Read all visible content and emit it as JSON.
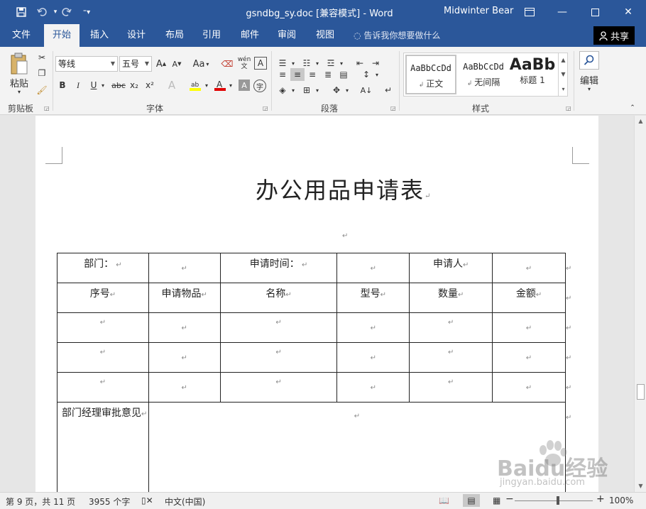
{
  "titlebar": {
    "title": "gsndbg_sy.doc [兼容模式] - Word",
    "user": "Midwinter Bear",
    "save_icon": "save-icon",
    "undo_icon": "undo-icon",
    "redo_icon": "redo-icon"
  },
  "tabs": [
    "文件",
    "开始",
    "插入",
    "设计",
    "布局",
    "引用",
    "邮件",
    "审阅",
    "视图"
  ],
  "active_tab": "开始",
  "tell_me": "告诉我你想要做什么",
  "share": "共享",
  "ribbon": {
    "clipboard": {
      "label": "剪贴板",
      "paste": "粘贴"
    },
    "font": {
      "label": "字体",
      "font_name": "等线",
      "font_size": "五号",
      "case": "Aa",
      "bold": "B",
      "italic": "I",
      "underline": "U",
      "strike": "abc",
      "sub": "x₂",
      "sup": "x²",
      "phonetic": "wén",
      "char_border": "A",
      "char_shade": "A",
      "enclose": "字"
    },
    "paragraph": {
      "label": "段落"
    },
    "styles": {
      "label": "样式",
      "items": [
        {
          "sample": "AaBbCcDd",
          "name": "正文"
        },
        {
          "sample": "AaBbCcDd",
          "name": "无间隔"
        },
        {
          "sample": "AaBb",
          "name": "标题 1"
        }
      ]
    },
    "editing": {
      "label": "编辑"
    }
  },
  "document": {
    "title": "办公用品申请表",
    "table": {
      "row1": [
        "部门：",
        "",
        "申请时间：",
        "",
        "申请人",
        ""
      ],
      "header": [
        "序号",
        "申请物品",
        "名称",
        "型号",
        "数量",
        "金额"
      ],
      "approval_label": "部门经理审批意见"
    }
  },
  "statusbar": {
    "page": "第 9 页，共 11 页",
    "words": "3955 个字",
    "language": "中文(中国)",
    "zoom": "100%",
    "zoom_minus": "−",
    "zoom_plus": "+"
  },
  "watermark": {
    "main": "Baidu经验",
    "sub": "jingyan.baidu.com"
  },
  "colors": {
    "word_blue": "#2b579a",
    "ribbon_bg": "#f3f3f3"
  }
}
